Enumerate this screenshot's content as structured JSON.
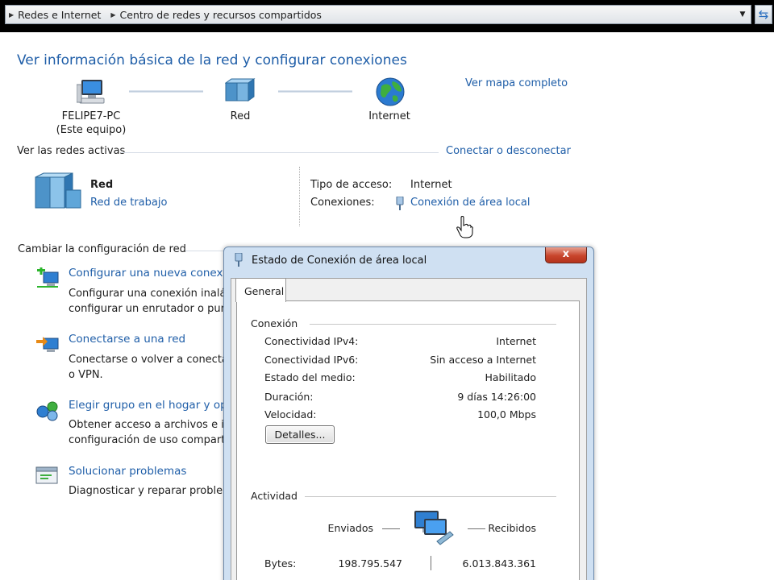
{
  "address": {
    "crumbs": [
      "Redes e Internet",
      "Centro de redes y recursos compartidos"
    ]
  },
  "page": {
    "title": "Ver información básica de la red y configurar conexiones",
    "map_link": "Ver mapa completo",
    "nodes": [
      {
        "name": "FELIPE7-PC",
        "sub": "(Este equipo)"
      },
      {
        "name": "Red"
      },
      {
        "name": "Internet"
      }
    ],
    "active_title": "Ver las redes activas",
    "connect_link": "Conectar o desconectar",
    "network": {
      "name": "Red",
      "type": "Red de trabajo",
      "access_label": "Tipo de acceso:",
      "access_value": "Internet",
      "conn_label": "Conexiones:",
      "conn_value": "Conexión de área local"
    },
    "change_title": "Cambiar la configuración de red",
    "tasks": [
      {
        "link": "Configurar una nueva conexión",
        "desc1": "Configurar una conexión inalán",
        "desc2": "configurar un enrutador o punt"
      },
      {
        "link": "Conectarse a una red",
        "desc1": "Conectarse o volver a conectars",
        "desc2": "o VPN."
      },
      {
        "link": "Elegir grupo en el hogar y opcio",
        "desc1": "Obtener acceso a archivos e im",
        "desc2": "configuración de uso comparti"
      },
      {
        "link": "Solucionar problemas",
        "desc1": "Diagnosticar y reparar problema",
        "desc2": ""
      }
    ]
  },
  "dialog": {
    "title": "Estado de Conexión de área local",
    "close": "x",
    "tab": "General",
    "conn_group": "Conexión",
    "rows": [
      {
        "label": "Conectividad IPv4:",
        "value": "Internet"
      },
      {
        "label": "Conectividad IPv6:",
        "value": "Sin acceso a Internet"
      },
      {
        "label": "Estado del medio:",
        "value": "Habilitado"
      },
      {
        "label": "Duración:",
        "value": "9 días 14:26:00"
      },
      {
        "label": "Velocidad:",
        "value": "100,0 Mbps"
      }
    ],
    "details_button": "Detalles...",
    "activity_group": "Actividad",
    "sent_label": "Enviados",
    "received_label": "Recibidos",
    "bytes_label": "Bytes:",
    "bytes_sent": "198.795.547",
    "bytes_received": "6.013.843.361"
  }
}
